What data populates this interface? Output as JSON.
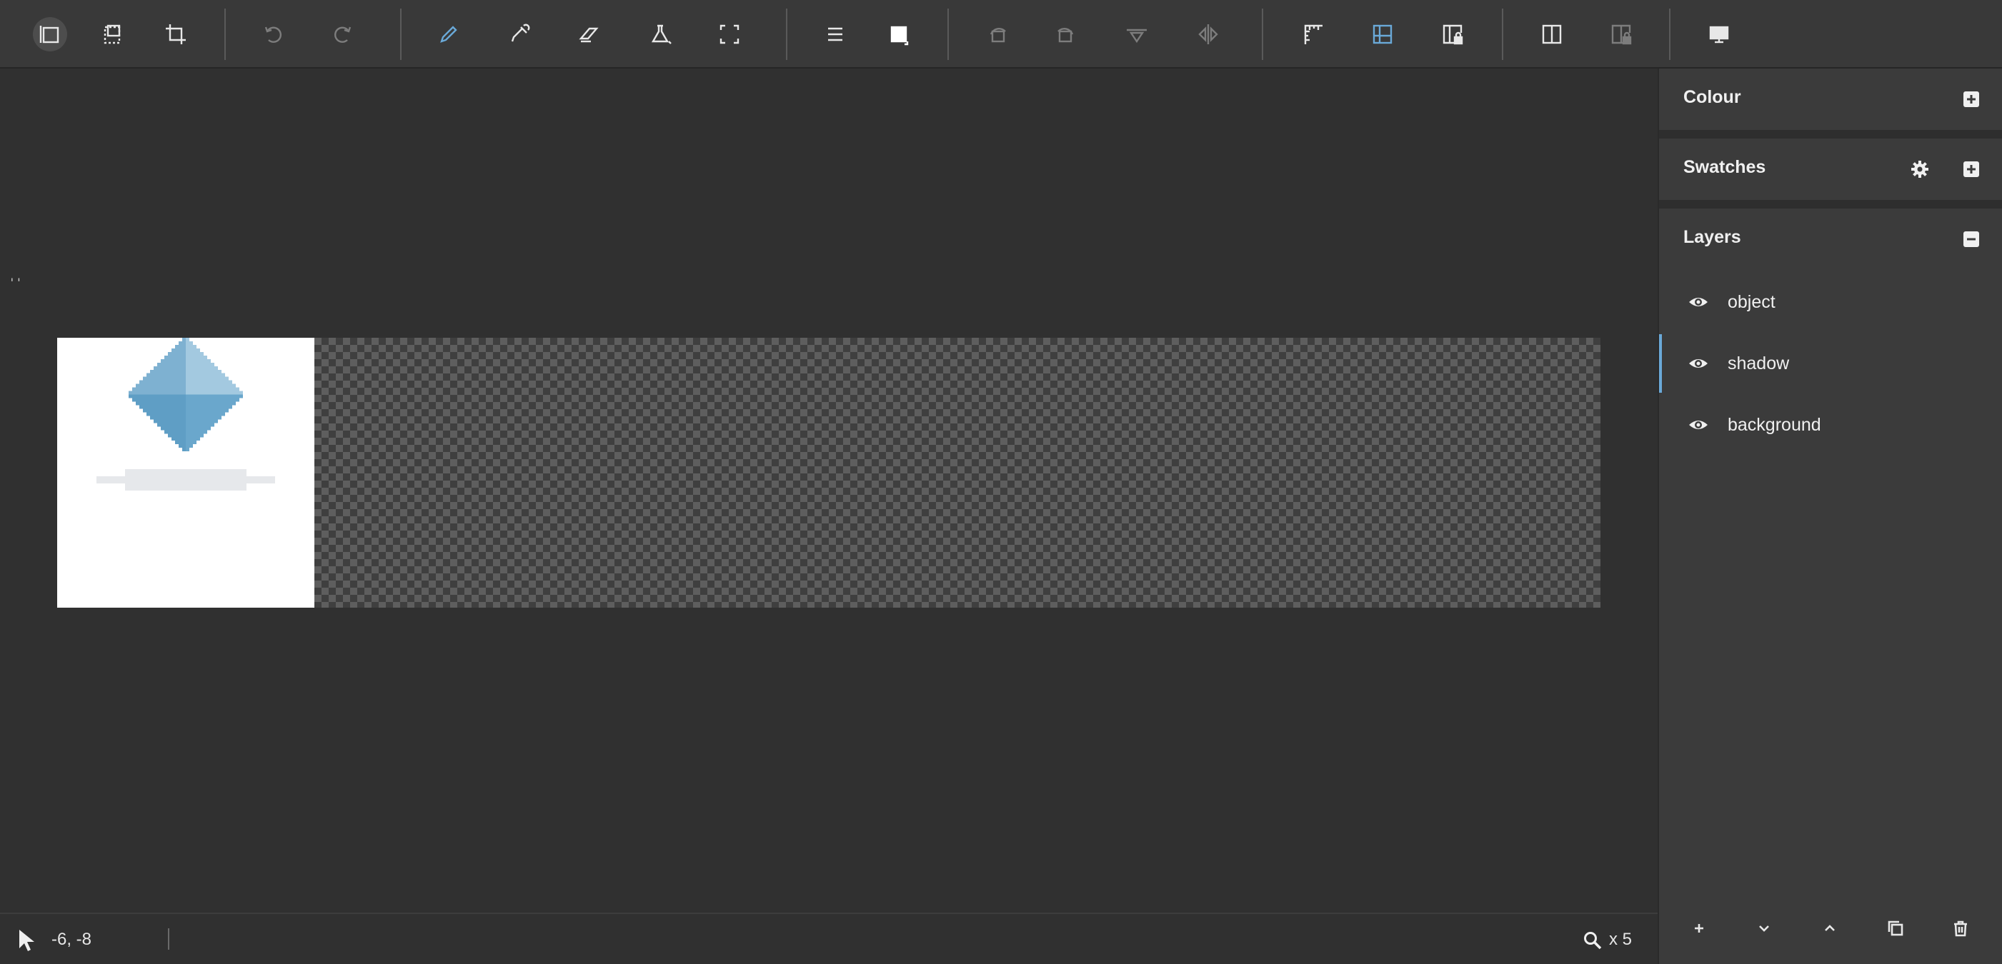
{
  "toolbar": {
    "groups": [
      [
        "select-tool",
        "marquee-tool",
        "crop-tool"
      ],
      [
        "undo",
        "redo"
      ],
      [
        "pencil-tool",
        "eyedropper-tool",
        "eraser-tool",
        "fill-tool",
        "fullscreen"
      ],
      [
        "menu",
        "color-swatch"
      ],
      [
        "rotate-left",
        "rotate-right",
        "flip-horizontal",
        "flip-vertical"
      ],
      [
        "ruler",
        "grid-toggle",
        "grid-lock"
      ],
      [
        "split-view",
        "split-lock"
      ],
      [
        "display"
      ]
    ]
  },
  "canvas": {
    "marker": "''"
  },
  "statusbar": {
    "coordinates": "-6, -8",
    "zoom": "x 5"
  },
  "panel": {
    "colour_title": "Colour",
    "swatches_title": "Swatches",
    "layers_title": "Layers",
    "layers": [
      {
        "name": "object",
        "visible": true,
        "selected": false
      },
      {
        "name": "shadow",
        "visible": true,
        "selected": true
      },
      {
        "name": "background",
        "visible": true,
        "selected": false
      }
    ]
  },
  "colors": {
    "accent": "#6aa9d8",
    "toolbar_bg": "#393939",
    "workspace_bg": "#303030",
    "panel_bg": "#3b3b3b"
  }
}
